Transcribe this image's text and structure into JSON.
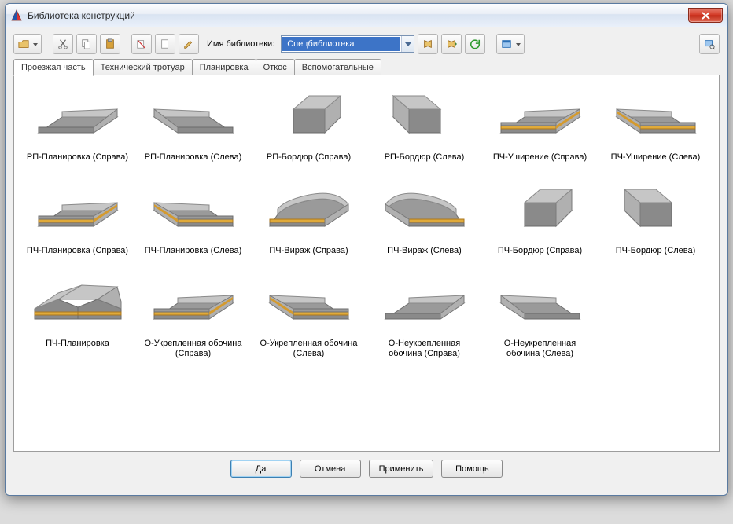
{
  "window": {
    "title": "Библиотека конструкций"
  },
  "toolbar": {
    "library_label": "Имя библиотеки:",
    "library_value": "Спецбиблиотека"
  },
  "tabs": [
    {
      "label": "Проезжая часть",
      "active": true
    },
    {
      "label": "Технический тротуар",
      "active": false
    },
    {
      "label": "Планировка",
      "active": false
    },
    {
      "label": "Откос",
      "active": false
    },
    {
      "label": "Вспомогательные",
      "active": false
    }
  ],
  "items": [
    {
      "label": "РП-Планировка (Справа)",
      "shape": "slab-plain",
      "mirror": false
    },
    {
      "label": "РП-Планировка (Слева)",
      "shape": "slab-plain",
      "mirror": true
    },
    {
      "label": "РП-Бордюр (Справа)",
      "shape": "block",
      "mirror": false
    },
    {
      "label": "РП-Бордюр (Слева)",
      "shape": "block",
      "mirror": true
    },
    {
      "label": "ПЧ-Уширение (Справа)",
      "shape": "slab-layer",
      "mirror": false
    },
    {
      "label": "ПЧ-Уширение (Слева)",
      "shape": "slab-layer",
      "mirror": true
    },
    {
      "label": "ПЧ-Планировка (Справа)",
      "shape": "slab-layer",
      "mirror": false
    },
    {
      "label": "ПЧ-Планировка (Слева)",
      "shape": "slab-layer",
      "mirror": true
    },
    {
      "label": "ПЧ-Вираж (Справа)",
      "shape": "curved",
      "mirror": false
    },
    {
      "label": "ПЧ-Вираж (Слева)",
      "shape": "curved",
      "mirror": true
    },
    {
      "label": "ПЧ-Бордюр (Справа)",
      "shape": "block",
      "mirror": false
    },
    {
      "label": "ПЧ-Бордюр (Слева)",
      "shape": "block",
      "mirror": true
    },
    {
      "label": "ПЧ-Планировка",
      "shape": "ridge",
      "mirror": false
    },
    {
      "label": "О-Укрепленная обочина (Справа)",
      "shape": "slab-layer",
      "mirror": false
    },
    {
      "label": "О-Укрепленная обочина (Слева)",
      "shape": "slab-layer",
      "mirror": true
    },
    {
      "label": "О-Неукрепленная обочина (Справа)",
      "shape": "slab-plain",
      "mirror": false
    },
    {
      "label": "О-Неукрепленная обочина (Слева)",
      "shape": "slab-plain",
      "mirror": true
    }
  ],
  "buttons": {
    "ok": "Да",
    "cancel": "Отмена",
    "apply": "Применить",
    "help": "Помощь"
  }
}
